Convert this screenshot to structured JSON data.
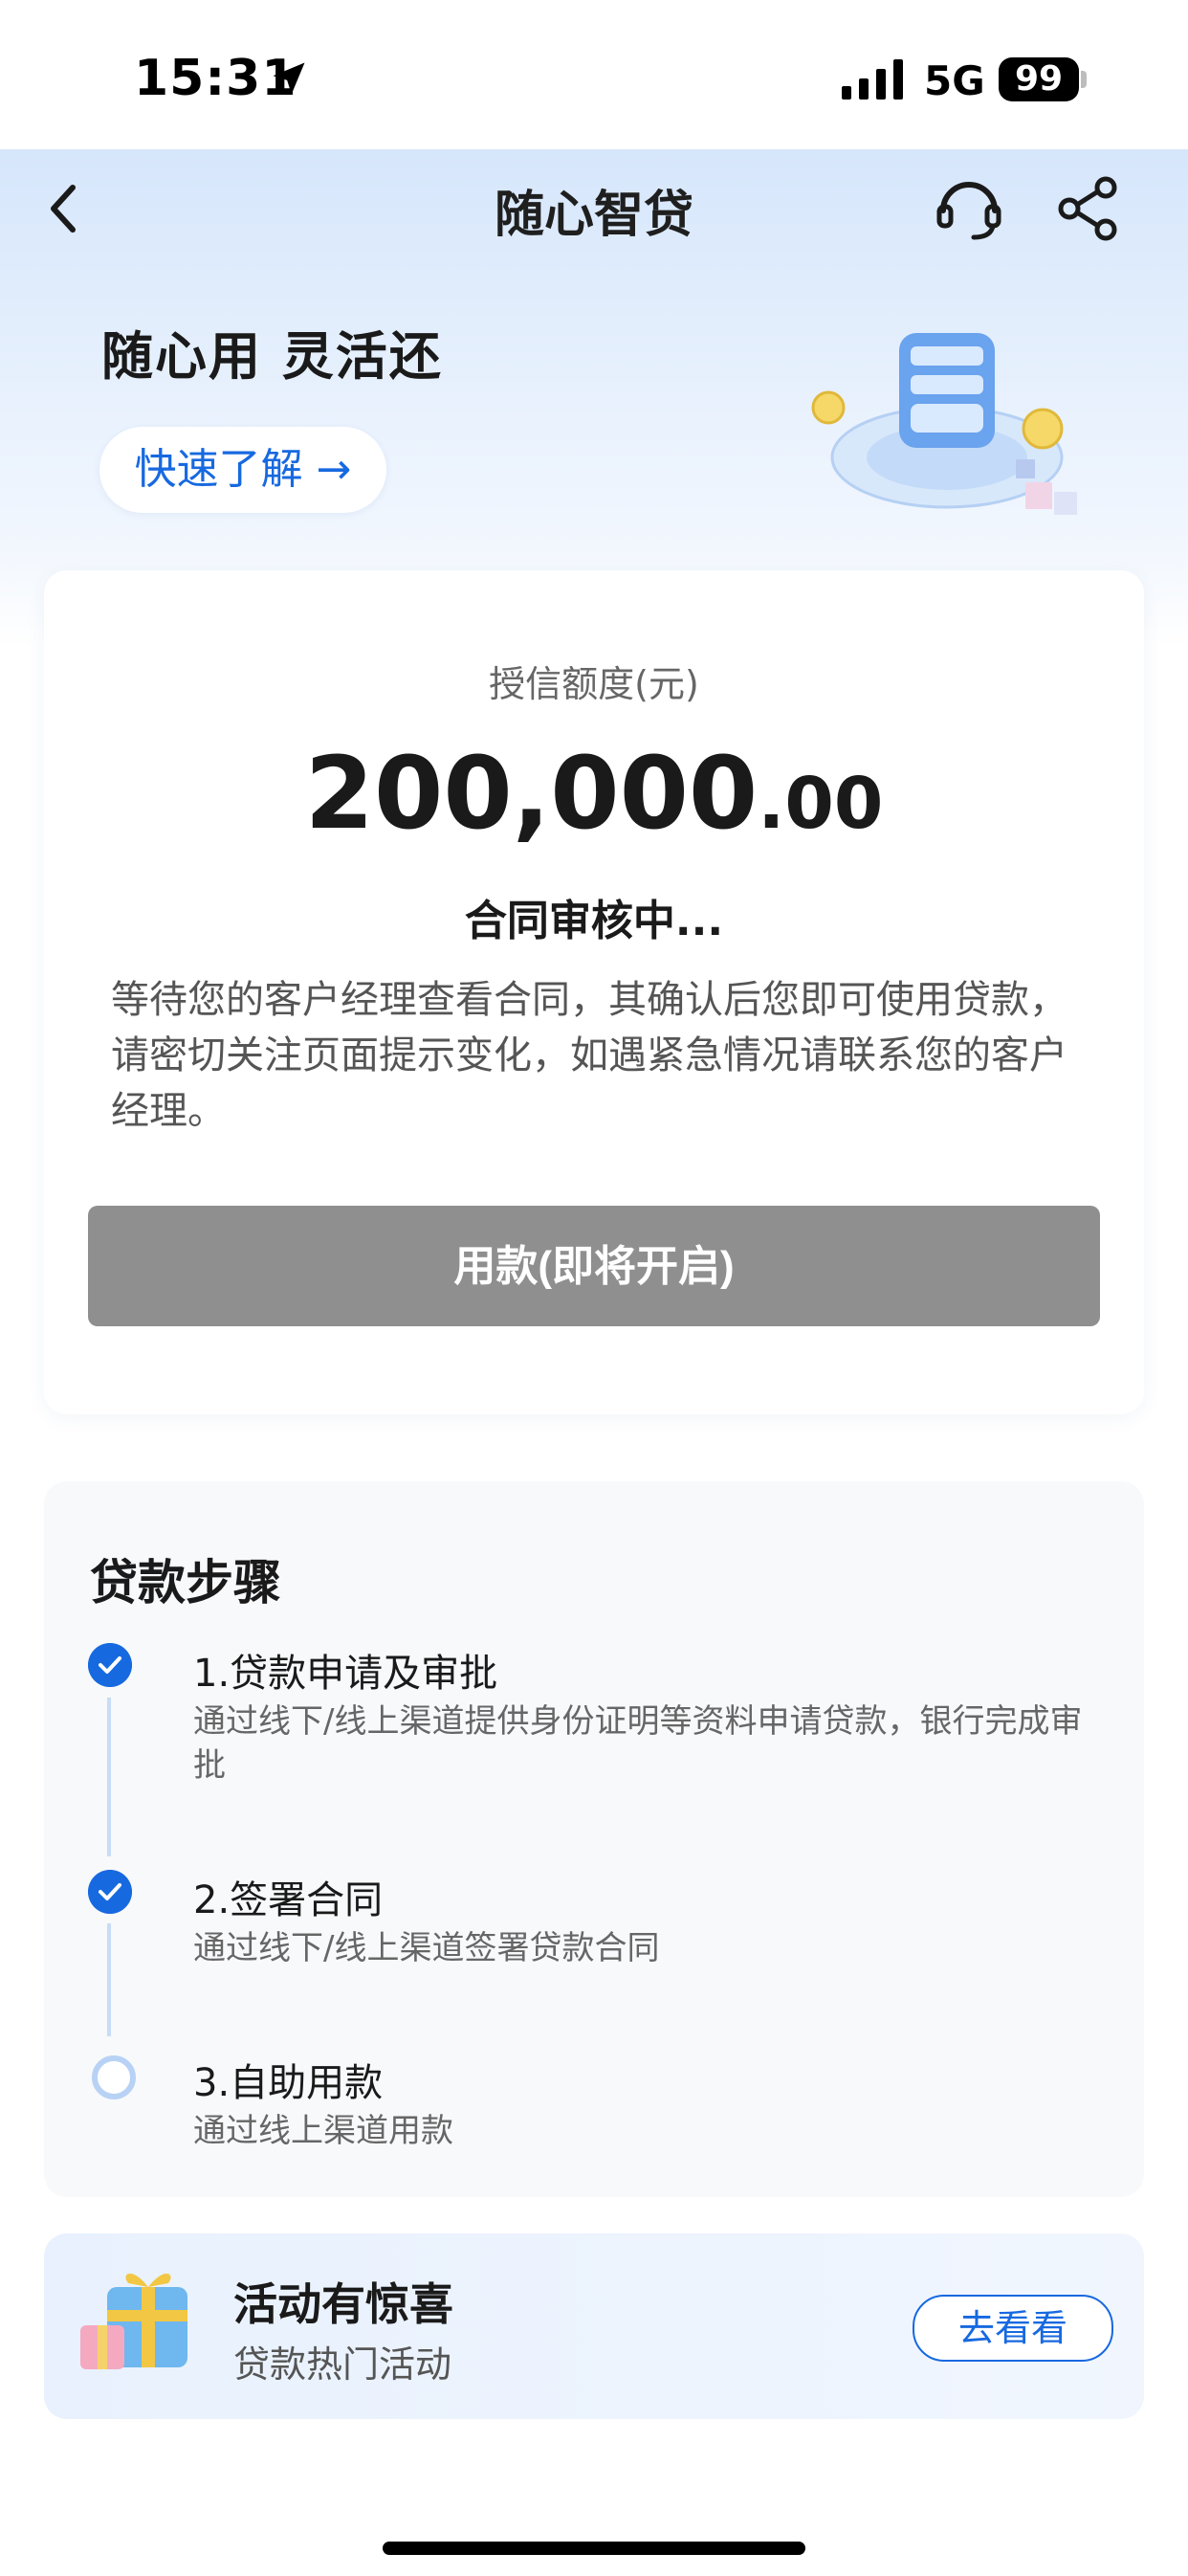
{
  "status_bar": {
    "time": "15:31",
    "network": "5G",
    "battery": "99"
  },
  "nav": {
    "title": "随心智贷"
  },
  "hero": {
    "title": "随心用 灵活还",
    "learn_button": "快速了解 →"
  },
  "credit": {
    "label": "授信额度(元)",
    "amount_integer": "200,000",
    "amount_decimal": ".00",
    "status_title": "合同审核中...",
    "status_desc": "等待您的客户经理查看合同，其确认后您即可使用贷款，请密切关注页面提示变化，如遇紧急情况请联系您的客户经理。",
    "use_button": "用款(即将开启)"
  },
  "steps": {
    "title": "贷款步骤",
    "items": [
      {
        "name": "1.贷款申请及审批",
        "desc": "通过线下/线上渠道提供身份证明等资料申请贷款，银行完成审批",
        "status": "done"
      },
      {
        "name": "2.签署合同",
        "desc": "通过线下/线上渠道签署贷款合同",
        "status": "done"
      },
      {
        "name": "3.自助用款",
        "desc": "通过线上渠道用款",
        "status": "pending"
      }
    ]
  },
  "activity": {
    "title": "活动有惊喜",
    "subtitle": "贷款热门活动",
    "button": "去看看"
  },
  "colors": {
    "accent": "#1769e0",
    "disabled_button": "#8f8f8f"
  }
}
